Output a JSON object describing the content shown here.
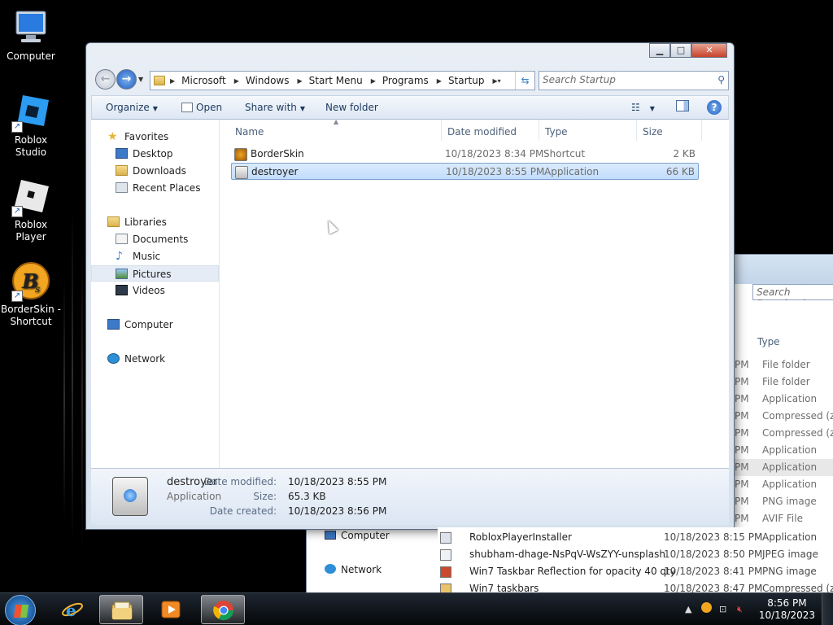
{
  "desktop": {
    "icons": [
      {
        "label": "Computer"
      },
      {
        "label": "Roblox Studio"
      },
      {
        "label": "Roblox Player"
      },
      {
        "label": "BorderSkin - Shortcut"
      }
    ]
  },
  "back_window": {
    "search_placeholder": "Search Downloads",
    "header_type": "Type",
    "nav": {
      "computer": "Computer",
      "network": "Network"
    },
    "rows": [
      {
        "time_suffix": "PM",
        "type": "File folder"
      },
      {
        "time_suffix": "PM",
        "type": "File folder"
      },
      {
        "time_suffix": "PM",
        "type": "Application"
      },
      {
        "time_suffix": "PM",
        "type": "Compressed (zip"
      },
      {
        "time_suffix": "PM",
        "type": "Compressed (zip"
      },
      {
        "time_suffix": "PM",
        "type": "Application"
      },
      {
        "time_suffix": "PM",
        "type": "Application"
      },
      {
        "time_suffix": "PM",
        "type": "Application"
      },
      {
        "time_suffix": "PM",
        "type": "PNG image"
      },
      {
        "time_suffix": "PM",
        "type": "AVIF File"
      }
    ],
    "files": [
      {
        "name": "RobloxPlayerInstaller",
        "date": "10/18/2023 8:15 PM",
        "type": "Application"
      },
      {
        "name": "shubham-dhage-NsPqV-WsZYY-unsplash",
        "date": "10/18/2023 8:50 PM",
        "type": "JPEG image"
      },
      {
        "name": "Win7 Taskbar Reflection for opacity 40 qty",
        "date": "10/18/2023 8:41 PM",
        "type": "PNG image"
      },
      {
        "name": "Win7 taskbars",
        "date": "10/18/2023 8:47 PM",
        "type": "Compressed (zip"
      }
    ]
  },
  "window": {
    "caption": {
      "minimize": "▁",
      "maximize": "□",
      "close": "✕"
    },
    "breadcrumbs": [
      "Microsoft",
      "Windows",
      "Start Menu",
      "Programs",
      "Startup"
    ],
    "search_placeholder": "Search Startup",
    "toolbar": {
      "organize": "Organize",
      "open": "Open",
      "share_with": "Share with",
      "new_folder": "New folder"
    },
    "nav_pane": {
      "favorites": "Favorites",
      "desktop": "Desktop",
      "downloads": "Downloads",
      "recent_places": "Recent Places",
      "libraries": "Libraries",
      "documents": "Documents",
      "music": "Music",
      "pictures": "Pictures",
      "videos": "Videos",
      "computer": "Computer",
      "network": "Network"
    },
    "columns": {
      "name": "Name",
      "date_modified": "Date modified",
      "type": "Type",
      "size": "Size"
    },
    "files": [
      {
        "name": "BorderSkin",
        "date": "10/18/2023 8:34 PM",
        "type": "Shortcut",
        "size": "2 KB",
        "icon": "shortcut-icon"
      },
      {
        "name": "destroyer",
        "date": "10/18/2023 8:55 PM",
        "type": "Application",
        "size": "66 KB",
        "icon": "application-icon"
      }
    ],
    "details": {
      "name": "destroyer",
      "kind": "Application",
      "date_modified_label": "Date modified:",
      "date_modified": "10/18/2023 8:55 PM",
      "size_label": "Size:",
      "size": "65.3 KB",
      "date_created_label": "Date created:",
      "date_created": "10/18/2023 8:56 PM"
    }
  },
  "taskbar": {
    "apps": [
      "internet-explorer-icon",
      "windows-explorer-icon",
      "media-player-icon",
      "chrome-icon"
    ],
    "clock_time": "8:56 PM",
    "clock_date": "10/18/2023"
  },
  "colors": {
    "selection": "#c1dcfc",
    "selection_border": "#7da2ce",
    "window_frame": "#d6e1ee",
    "accent_blue": "#1d5cc5"
  }
}
